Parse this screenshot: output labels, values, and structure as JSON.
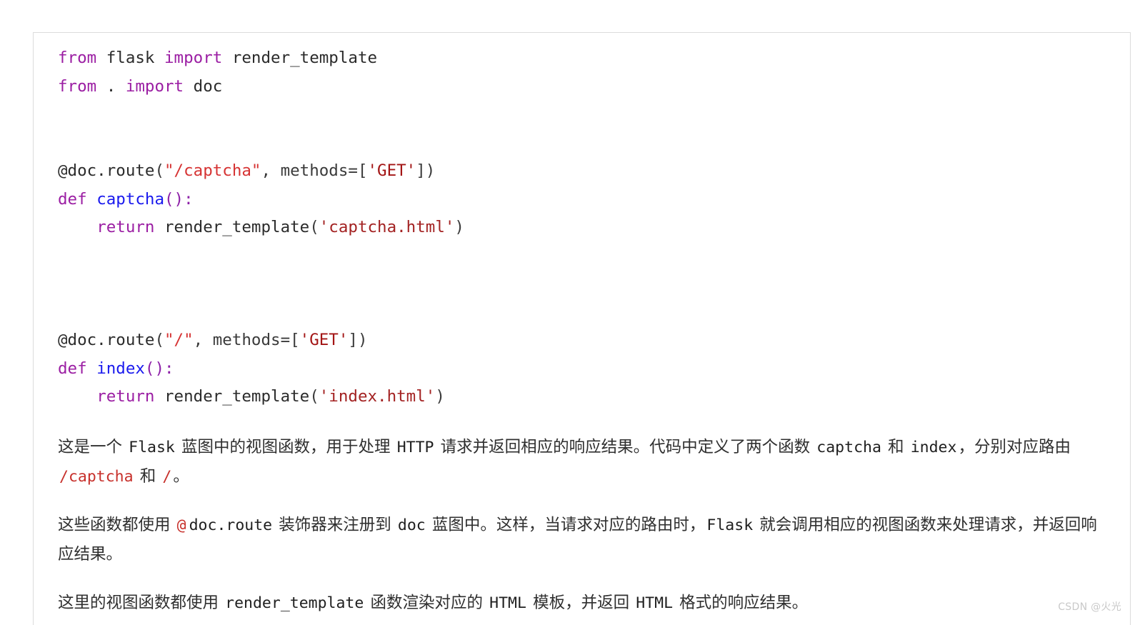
{
  "card": {
    "background": "#ffffff",
    "border_color": "#dcdcdc"
  },
  "code_block": {
    "language": "python",
    "colors": {
      "keyword": "#9b1ea3",
      "function_name": "#1a1aee",
      "double_quoted_string": "#d63333",
      "single_quoted_string": "#a32222",
      "plain": "#2b2b2b"
    },
    "lines": [
      {
        "tokens": [
          {
            "t": "from",
            "c": "k"
          },
          {
            "t": " flask ",
            "c": "pl"
          },
          {
            "t": "import",
            "c": "k"
          },
          {
            "t": " render_template",
            "c": "pl"
          }
        ]
      },
      {
        "tokens": [
          {
            "t": "from",
            "c": "k"
          },
          {
            "t": " . ",
            "c": "pl"
          },
          {
            "t": "import",
            "c": "k"
          },
          {
            "t": " doc",
            "c": "pl"
          }
        ]
      },
      {
        "tokens": []
      },
      {
        "tokens": []
      },
      {
        "tokens": [
          {
            "t": "@doc.route",
            "c": "pl"
          },
          {
            "t": "(",
            "c": "op"
          },
          {
            "t": "\"/captcha\"",
            "c": "str2"
          },
          {
            "t": ", methods=[",
            "c": "op"
          },
          {
            "t": "'GET'",
            "c": "gets"
          },
          {
            "t": "])",
            "c": "op"
          }
        ]
      },
      {
        "tokens": [
          {
            "t": "def",
            "c": "k"
          },
          {
            "t": " ",
            "c": "pl"
          },
          {
            "t": "captcha",
            "c": "fn"
          },
          {
            "t": "():",
            "c": "pn"
          }
        ]
      },
      {
        "tokens": [
          {
            "t": "    ",
            "c": "pl"
          },
          {
            "t": "return",
            "c": "k"
          },
          {
            "t": " render_template",
            "c": "pl"
          },
          {
            "t": "(",
            "c": "op"
          },
          {
            "t": "'captcha.html'",
            "c": "str1"
          },
          {
            "t": ")",
            "c": "op"
          }
        ]
      },
      {
        "tokens": []
      },
      {
        "tokens": []
      },
      {
        "tokens": []
      },
      {
        "tokens": [
          {
            "t": "@doc.route",
            "c": "pl"
          },
          {
            "t": "(",
            "c": "op"
          },
          {
            "t": "\"/\"",
            "c": "str2"
          },
          {
            "t": ", methods=[",
            "c": "op"
          },
          {
            "t": "'GET'",
            "c": "gets"
          },
          {
            "t": "])",
            "c": "op"
          }
        ]
      },
      {
        "tokens": [
          {
            "t": "def",
            "c": "k"
          },
          {
            "t": " ",
            "c": "pl"
          },
          {
            "t": "index",
            "c": "fn"
          },
          {
            "t": "():",
            "c": "pn"
          }
        ]
      },
      {
        "tokens": [
          {
            "t": "    ",
            "c": "pl"
          },
          {
            "t": "return",
            "c": "k"
          },
          {
            "t": " render_template",
            "c": "pl"
          },
          {
            "t": "(",
            "c": "op"
          },
          {
            "t": "'index.html'",
            "c": "str1"
          },
          {
            "t": ")",
            "c": "op"
          }
        ]
      }
    ],
    "plain_text": "from flask import render_template\nfrom . import doc\n\n\n@doc.route(\"/captcha\", methods=['GET'])\ndef captcha():\n    return render_template('captcha.html')\n\n\n\n@doc.route(\"/\", methods=['GET'])\ndef index():\n    return render_template('index.html')"
  },
  "paragraphs": [
    {
      "id": "para-1",
      "runs": [
        {
          "t": "这是一个 ",
          "style": "text"
        },
        {
          "t": "Flask",
          "style": "code-dark"
        },
        {
          "t": " 蓝图中的视图函数，用于处理 ",
          "style": "text"
        },
        {
          "t": "HTTP",
          "style": "code-dark"
        },
        {
          "t": " 请求并返回相应的响应结果。代码中定义了两个函数 ",
          "style": "text"
        },
        {
          "t": "captcha",
          "style": "code-dark"
        },
        {
          "t": " 和 ",
          "style": "text"
        },
        {
          "t": "index",
          "style": "code-dark"
        },
        {
          "t": "，分别对应路由 ",
          "style": "text"
        },
        {
          "t": "/captcha",
          "style": "code-red"
        },
        {
          "t": " 和 ",
          "style": "text"
        },
        {
          "t": "/",
          "style": "code-red"
        },
        {
          "t": "。",
          "style": "text"
        }
      ],
      "plain_text": "这是一个 Flask 蓝图中的视图函数，用于处理 HTTP 请求并返回相应的响应结果。代码中定义了两个函数 captcha 和 index，分别对应路由 /captcha 和 /。"
    },
    {
      "id": "para-2",
      "runs": [
        {
          "t": "这些函数都使用 ",
          "style": "text"
        },
        {
          "t": "@",
          "style": "at-red"
        },
        {
          "t": "doc.route",
          "style": "code-dark"
        },
        {
          "t": " 装饰器来注册到 ",
          "style": "text"
        },
        {
          "t": "doc",
          "style": "code-dark"
        },
        {
          "t": " 蓝图中。这样，当请求对应的路由时，",
          "style": "text"
        },
        {
          "t": "Flask",
          "style": "code-dark"
        },
        {
          "t": " 就会调用相应的视图函数来处理请求，并返回响应结果。",
          "style": "text"
        }
      ],
      "plain_text": "这些函数都使用 @doc.route 装饰器来注册到 doc 蓝图中。这样，当请求对应的路由时，Flask 就会调用相应的视图函数来处理请求，并返回响应结果。"
    },
    {
      "id": "para-3",
      "runs": [
        {
          "t": "这里的视图函数都使用 ",
          "style": "text"
        },
        {
          "t": "render_template",
          "style": "code-dark"
        },
        {
          "t": " 函数渲染对应的 ",
          "style": "text"
        },
        {
          "t": "HTML",
          "style": "code-dark"
        },
        {
          "t": " 模板，并返回 ",
          "style": "text"
        },
        {
          "t": "HTML",
          "style": "code-dark"
        },
        {
          "t": " 格式的响应结果。",
          "style": "text"
        }
      ],
      "plain_text": "这里的视图函数都使用 render_template 函数渲染对应的 HTML 模板，并返回 HTML 格式的响应结果。"
    }
  ],
  "watermark": {
    "text": "CSDN @火光",
    "color": "#c9c9c9"
  }
}
